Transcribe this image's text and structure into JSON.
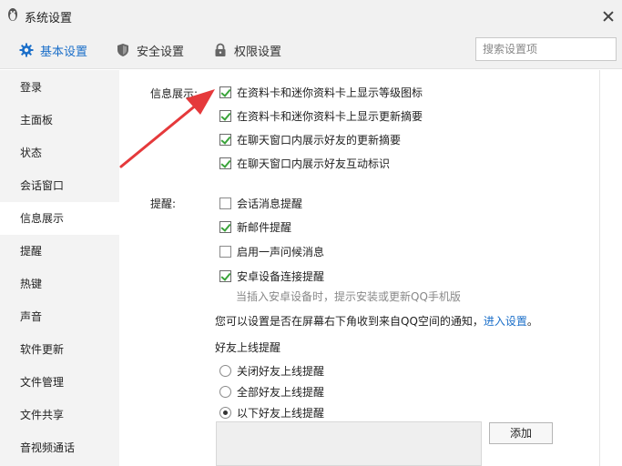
{
  "window": {
    "title": "系统设置"
  },
  "tabs": [
    {
      "label": "基本设置",
      "icon": "gear-icon"
    },
    {
      "label": "安全设置",
      "icon": "shield-icon"
    },
    {
      "label": "权限设置",
      "icon": "lock-icon"
    }
  ],
  "search": {
    "placeholder": "搜索设置项"
  },
  "sidebar": {
    "items": [
      "登录",
      "主面板",
      "状态",
      "会话窗口",
      "信息展示",
      "提醒",
      "热键",
      "声音",
      "软件更新",
      "文件管理",
      "文件共享",
      "音视频通话"
    ],
    "active": "信息展示"
  },
  "info_display": {
    "label": "信息展示:",
    "options": [
      {
        "text": "在资料卡和迷你资料卡上显示等级图标",
        "checked": true
      },
      {
        "text": "在资料卡和迷你资料卡上显示更新摘要",
        "checked": true
      },
      {
        "text": "在聊天窗口内展示好友的更新摘要",
        "checked": true
      },
      {
        "text": "在聊天窗口内展示好友互动标识",
        "checked": true
      }
    ]
  },
  "reminder": {
    "label": "提醒:",
    "options": [
      {
        "text": "会话消息提醒",
        "checked": false
      },
      {
        "text": "新邮件提醒",
        "checked": true
      },
      {
        "text": "启用一声问候消息",
        "checked": false
      },
      {
        "text": "安卓设备连接提醒",
        "checked": true
      }
    ],
    "hint": "当插入安卓设备时，提示安装或更新QQ手机版",
    "notice_text": "您可以设置是否在屏幕右下角收到来自QQ空间的通知，",
    "notice_link": "进入设置",
    "notice_end": "。"
  },
  "friend_online": {
    "label": "好友上线提醒",
    "options": [
      {
        "text": "关闭好友上线提醒",
        "checked": false
      },
      {
        "text": "全部好友上线提醒",
        "checked": false
      },
      {
        "text": "以下好友上线提醒",
        "checked": true
      }
    ],
    "add_label": "添加"
  },
  "colors": {
    "accent": "#1b6fc9",
    "check": "#3aa33a",
    "arrow": "#e5393b"
  }
}
